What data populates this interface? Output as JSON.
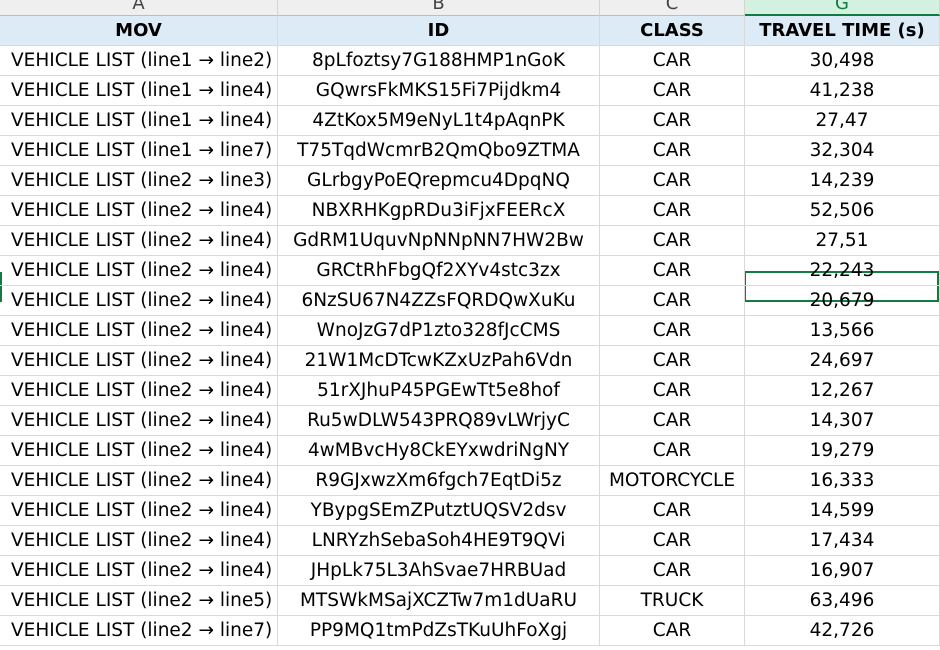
{
  "column_letters": [
    "A",
    "B",
    "C",
    "G"
  ],
  "headers": {
    "mov": "MOV",
    "id": "ID",
    "class": "CLASS",
    "travel_time": "TRAVEL TIME (s)"
  },
  "rows": [
    {
      "mov": "VEHICLE LIST (line1 → line2)",
      "id": "8pLfoztsy7G188HMP1nGoK",
      "class": "CAR",
      "travel_time": "30,498"
    },
    {
      "mov": "VEHICLE LIST (line1 → line4)",
      "id": "GQwrsFkMKS15Fi7Pijdkm4",
      "class": "CAR",
      "travel_time": "41,238"
    },
    {
      "mov": "VEHICLE LIST (line1 → line4)",
      "id": "4ZtKox5M9eNyL1t4pAqnPK",
      "class": "CAR",
      "travel_time": "27,47"
    },
    {
      "mov": "VEHICLE LIST (line1 → line7)",
      "id": "T75TqdWcmrB2QmQbo9ZTMA",
      "class": "CAR",
      "travel_time": "32,304"
    },
    {
      "mov": "VEHICLE LIST (line2 → line3)",
      "id": "GLrbgyPoEQrepmcu4DpqNQ",
      "class": "CAR",
      "travel_time": "14,239"
    },
    {
      "mov": "VEHICLE LIST (line2 → line4)",
      "id": "NBXRHKgpRDu3iFjxFEERcX",
      "class": "CAR",
      "travel_time": "52,506"
    },
    {
      "mov": "VEHICLE LIST (line2 → line4)",
      "id": "GdRM1UquvNpNNpNN7HW2Bw",
      "class": "CAR",
      "travel_time": "27,51"
    },
    {
      "mov": "VEHICLE LIST (line2 → line4)",
      "id": "GRCtRhFbgQf2XYv4stc3zx",
      "class": "CAR",
      "travel_time": "22,243"
    },
    {
      "mov": "VEHICLE LIST (line2 → line4)",
      "id": "6NzSU67N4ZZsFQRDQwXuKu",
      "class": "CAR",
      "travel_time": "20,679"
    },
    {
      "mov": "VEHICLE LIST (line2 → line4)",
      "id": "WnoJzG7dP1zto328fJcCMS",
      "class": "CAR",
      "travel_time": "13,566"
    },
    {
      "mov": "VEHICLE LIST (line2 → line4)",
      "id": "21W1McDTcwKZxUzPah6Vdn",
      "class": "CAR",
      "travel_time": "24,697"
    },
    {
      "mov": "VEHICLE LIST (line2 → line4)",
      "id": "51rXJhuP45PGEwTt5e8hof",
      "class": "CAR",
      "travel_time": "12,267"
    },
    {
      "mov": "VEHICLE LIST (line2 → line4)",
      "id": "Ru5wDLW543PRQ89vLWrjyC",
      "class": "CAR",
      "travel_time": "14,307"
    },
    {
      "mov": "VEHICLE LIST (line2 → line4)",
      "id": "4wMBvcHy8CkEYxwdriNgNY",
      "class": "CAR",
      "travel_time": "19,279"
    },
    {
      "mov": "VEHICLE LIST (line2 → line4)",
      "id": "R9GJxwzXm6fgch7EqtDi5z",
      "class": "MOTORCYCLE",
      "travel_time": "16,333"
    },
    {
      "mov": "VEHICLE LIST (line2 → line4)",
      "id": "YBypgSEmZPutztUQSV2dsv",
      "class": "CAR",
      "travel_time": "14,599"
    },
    {
      "mov": "VEHICLE LIST (line2 → line4)",
      "id": "LNRYzhSebaSoh4HE9T9QVi",
      "class": "CAR",
      "travel_time": "17,434"
    },
    {
      "mov": "VEHICLE LIST (line2 → line4)",
      "id": "JHpLk75L3AhSvae7HRBUad",
      "class": "CAR",
      "travel_time": "16,907"
    },
    {
      "mov": "VEHICLE LIST (line2 → line5)",
      "id": "MTSWkMSajXCZTw7m1dUaRU",
      "class": "TRUCK",
      "travel_time": "63,496"
    },
    {
      "mov": "VEHICLE LIST (line2 → line7)",
      "id": "PP9MQ1tmPdZsTKuUhFoXgj",
      "class": "CAR",
      "travel_time": "42,726"
    }
  ],
  "selected_row_index": 7,
  "colors": {
    "header_fill": "#ddebf7",
    "selection_accent": "#107c41",
    "gridline": "#d9d9d9"
  }
}
